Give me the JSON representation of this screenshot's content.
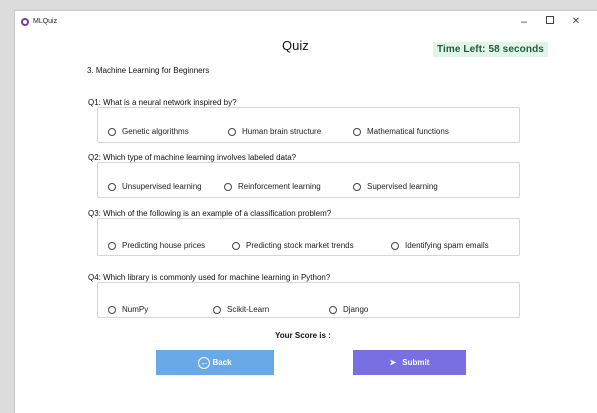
{
  "window": {
    "app_title": "MLQuiz",
    "controls": {
      "minimize": "–",
      "close": "✕"
    }
  },
  "header": {
    "title": "Quiz",
    "timer": "Time Left: 58 seconds"
  },
  "quiz_name": "3. Machine Learning for Beginners",
  "questions": [
    {
      "text": "Q1: What is a neural network inspired by?",
      "options": [
        "Genetic algorithms",
        "Human brain structure",
        "Mathematical functions"
      ]
    },
    {
      "text": "Q2: Which type of machine learning involves labeled data?",
      "options": [
        "Unsupervised learning",
        "Reinforcement learning",
        "Supervised learning"
      ]
    },
    {
      "text": "Q3: Which of the following is an example of a classification problem?",
      "options": [
        "Predicting house prices",
        "Predicting stock market trends",
        "Identifying spam emails"
      ]
    },
    {
      "text": "Q4: Which library is commonly used for machine learning in Python?",
      "options": [
        "NumPy",
        "Scikit-Learn",
        "Django"
      ]
    }
  ],
  "score_label": "Your Score  is :",
  "buttons": {
    "back_label": "Back",
    "back_icon": "←",
    "submit_label": "Submit",
    "submit_icon": "➤"
  },
  "colors": {
    "back_button": "#6aa9e8",
    "submit_button": "#7a6fe2",
    "timer_text": "#1f5e3a",
    "timer_background": "#e2f3ea"
  }
}
